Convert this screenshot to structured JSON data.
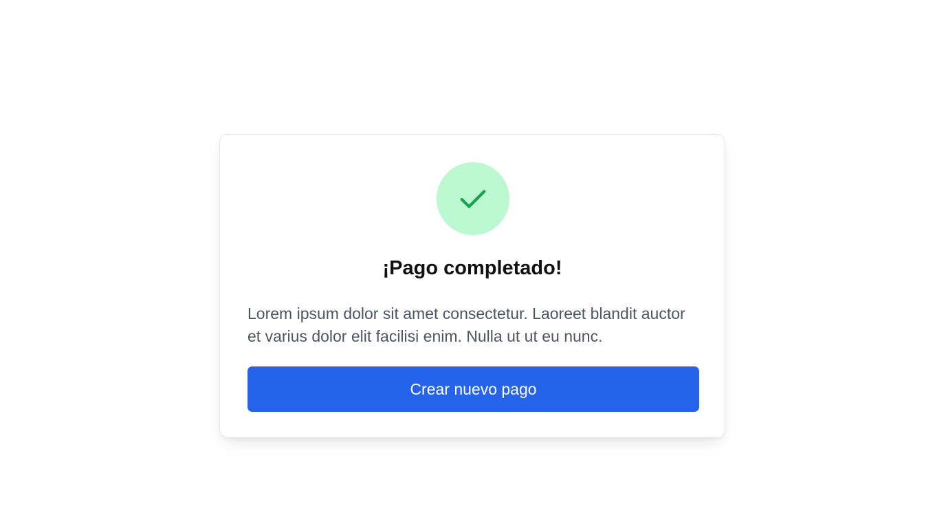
{
  "card": {
    "title": "¡Pago completado!",
    "description": "Lorem ipsum dolor sit amet consectetur. Laoreet blandit auctor et varius dolor elit facilisi enim. Nulla ut ut eu nunc.",
    "button_label": "Crear nuevo pago",
    "icon": "check-icon"
  },
  "colors": {
    "accent": "#2563eb",
    "success_bg": "#bbf7d0",
    "success_fg": "#16a34a",
    "title_text": "#111111",
    "body_text": "#4b5563"
  }
}
